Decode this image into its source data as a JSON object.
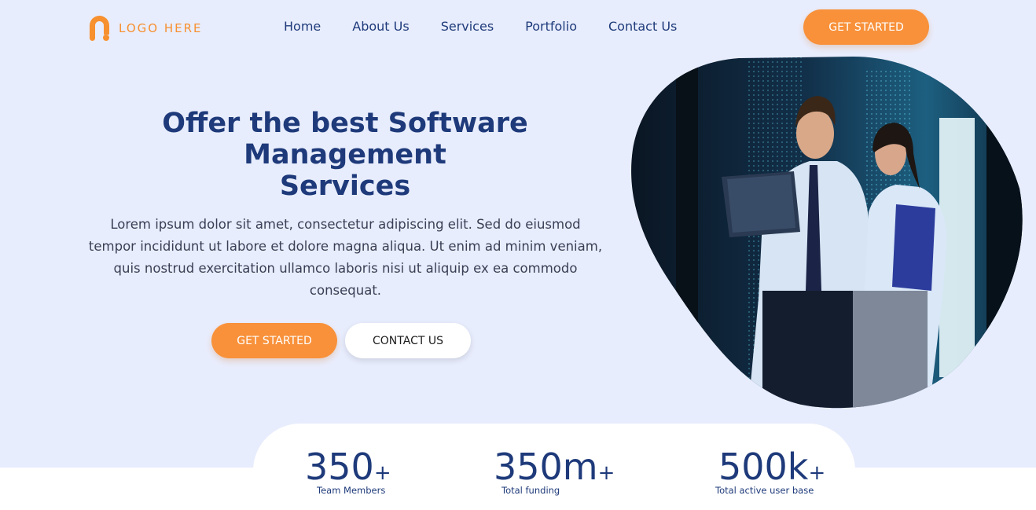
{
  "header": {
    "logo_text": "LOGO HERE",
    "nav": [
      {
        "label": "Home"
      },
      {
        "label": "About Us"
      },
      {
        "label": "Services"
      },
      {
        "label": "Portfolio"
      },
      {
        "label": "Contact Us"
      }
    ],
    "cta_label": "GET STARTED"
  },
  "hero": {
    "title_lines": [
      "Offer the best Software",
      "Management",
      "Services"
    ],
    "description": "Lorem ipsum dolor sit amet, consectetur adipiscing elit. Sed do eiusmod tempor incididunt ut labore et dolore magna aliqua. Ut enim ad minim veniam, quis nostrud exercitation ullamco laboris nisi ut aliquip ex ea commodo consequat.",
    "primary_button": "GET STARTED",
    "secondary_button": "CONTACT US"
  },
  "stats": [
    {
      "value": "350",
      "suffix": "+",
      "label": "Team Members"
    },
    {
      "value": "350m",
      "suffix": "+",
      "label": "Total funding"
    },
    {
      "value": "500k",
      "suffix": "+",
      "label": "Total active user base"
    }
  ],
  "colors": {
    "accent": "#f8913a",
    "primary_text": "#1e3a7a",
    "hero_background": "#e8edfd"
  }
}
